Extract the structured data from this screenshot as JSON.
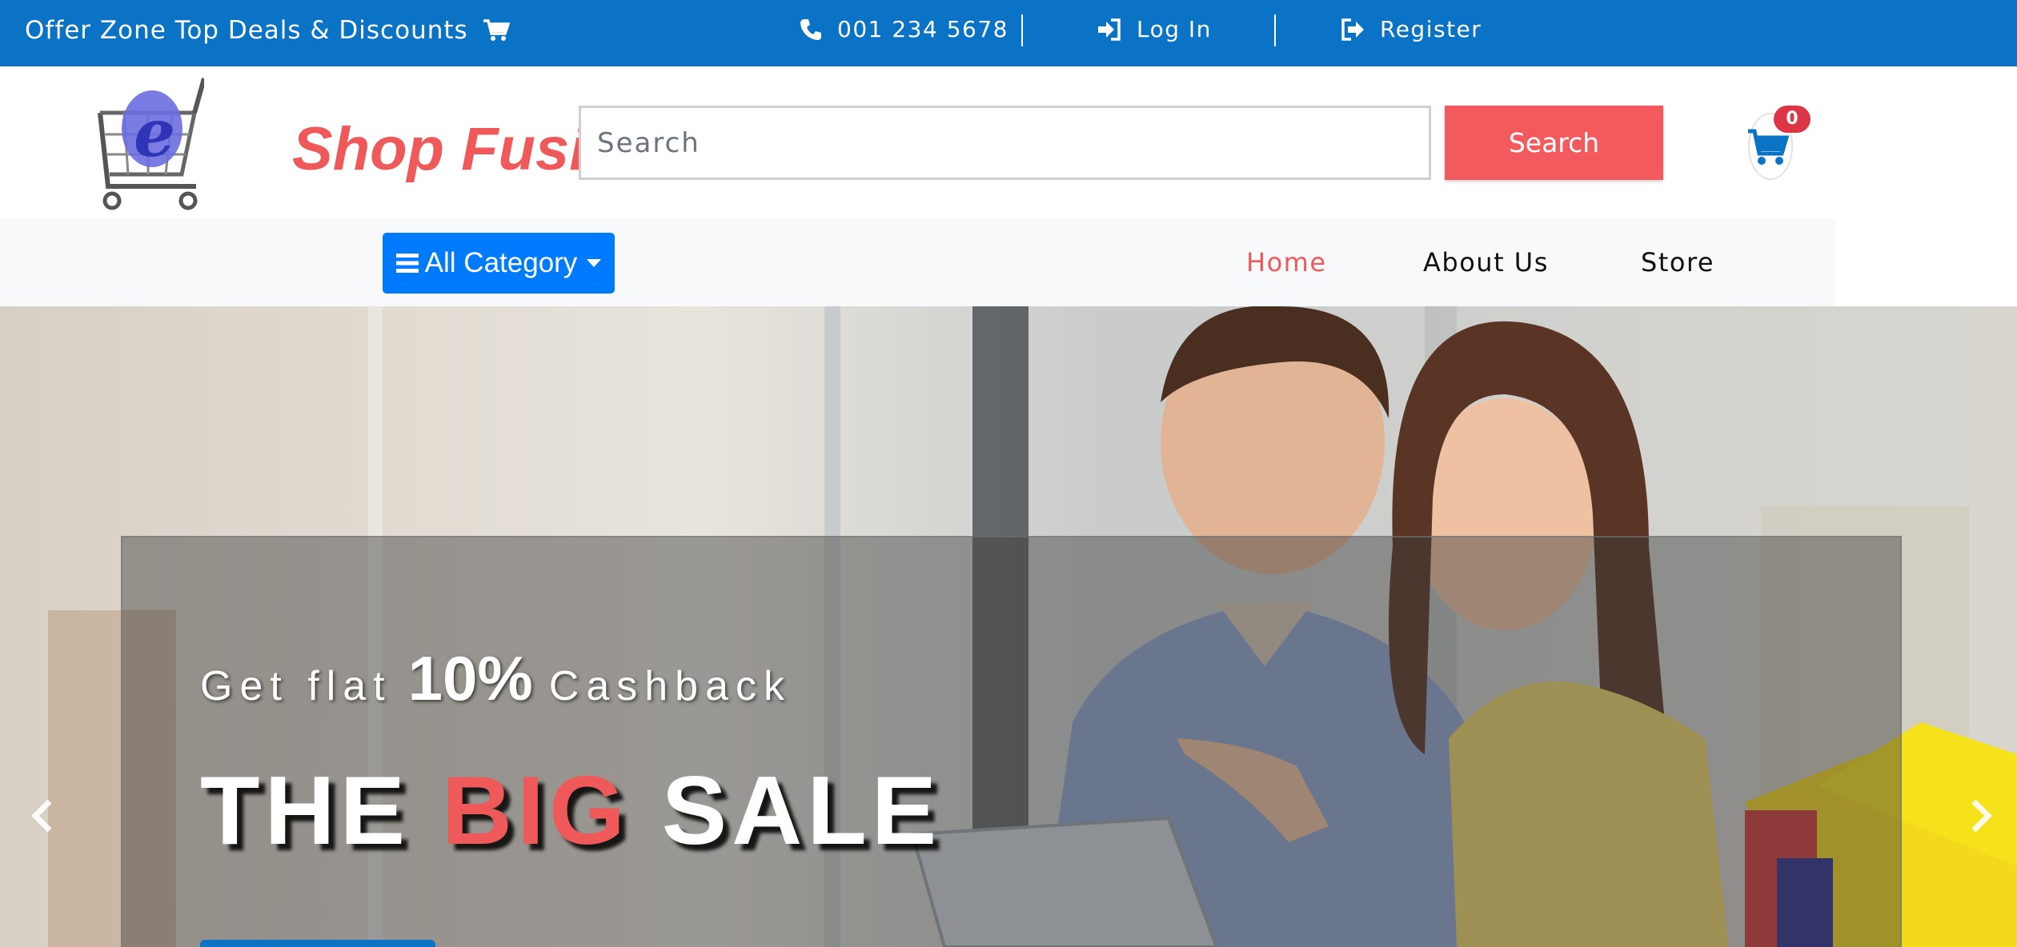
{
  "topbar": {
    "offer": "Offer Zone Top Deals & Discounts",
    "phone": "001 234 5678",
    "login": "Log In",
    "register": "Register"
  },
  "header": {
    "logo_text": "Shop Fusion",
    "search_placeholder": "Search",
    "search_button": "Search",
    "cart_count": "0"
  },
  "nav": {
    "category_button": "All Category",
    "links": [
      {
        "label": "Home",
        "active": true
      },
      {
        "label": "About Us",
        "active": false
      },
      {
        "label": "Store",
        "active": false
      }
    ]
  },
  "hero": {
    "cashback_pre": "Get flat",
    "cashback_pct": "10%",
    "cashback_post": "Cashback",
    "headline_1": "THE",
    "headline_2": "BIG",
    "headline_3": "SALE",
    "prev_icon": "chevron-left-icon",
    "next_icon": "chevron-right-icon"
  },
  "colors": {
    "topbar": "#0a73c6",
    "brand": "#f0595a",
    "category_button": "#007bff",
    "badge": "#dc3545"
  }
}
